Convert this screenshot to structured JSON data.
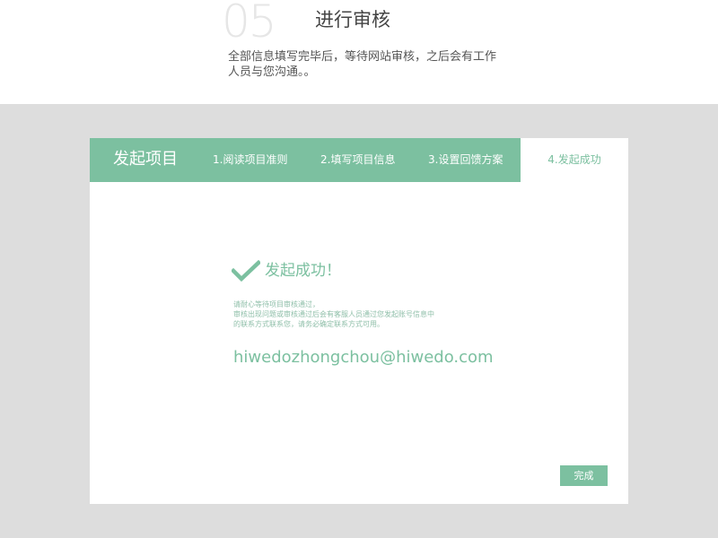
{
  "header": {
    "step_number": "05",
    "title": "进行审核",
    "description": "全部信息填写完毕后，等待网站审核，之后会有工作人员与您沟通。。"
  },
  "card": {
    "brand": "发起项目",
    "tabs": [
      {
        "label": "1.阅读项目准则",
        "active": false
      },
      {
        "label": "2.填写项目信息",
        "active": false
      },
      {
        "label": "3.设置回馈方案",
        "active": false
      },
      {
        "label": "4.发起成功",
        "active": true
      }
    ],
    "success_icon": "check-icon",
    "success_title": "发起成功！",
    "notice_lines": [
      "请耐心等待项目审核通过，",
      "审核出现问题或审核通过后会有客服人员通过您发起账号信息中",
      "的联系方式联系您，请务必确定联系方式可用。"
    ],
    "email": "hiwedozhongchou@hiwedo.com",
    "done_label": "完成"
  },
  "colors": {
    "accent": "#7cc0a0",
    "background_gray": "#dddddd",
    "step_number": "#e6e6e6"
  }
}
